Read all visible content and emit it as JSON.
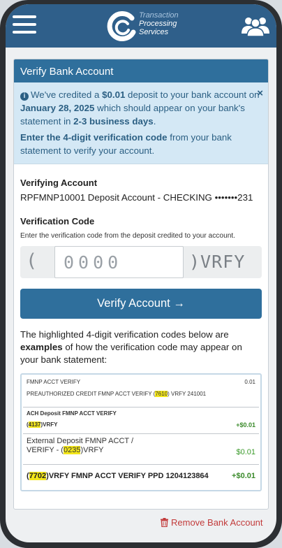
{
  "header": {
    "logo_lines": [
      "Transaction",
      "Processing",
      "Services"
    ]
  },
  "card": {
    "title": "Verify Bank Account"
  },
  "alert": {
    "p1_a": "We've credited a ",
    "amount": "$0.01",
    "p1_b": " deposit to your bank account on ",
    "date": "January 28, 2025",
    "p1_c": " which should appear on your bank's statement in ",
    "days": "2-3 business days",
    "p1_d": ".",
    "p2_bold": "Enter the 4-digit verification code",
    "p2_rest": " from your bank statement to verify your account.",
    "close": "×"
  },
  "verifying": {
    "label": "Verifying Account",
    "value": "RPFMNP10001 Deposit Account - CHECKING •••••••231"
  },
  "verification": {
    "label": "Verification Code",
    "help": "Enter the verification code from the deposit credited to your account.",
    "paren_open": "(",
    "placeholder": "0000",
    "suffix": ")VRFY"
  },
  "verify_button": "Verify Account →",
  "examples_intro": {
    "a": "The highlighted 4-digit verification codes below are ",
    "bold": "examples",
    "b": " of how the verification code may appear on your bank statement:"
  },
  "examples": {
    "e1": {
      "desc": "FMNP ACCT VERIFY",
      "amount": "0.01",
      "line2_a": "PREAUTHORIZED CREDIT FMNP ACCT VERIFY (",
      "code": "7610",
      "line2_b": ") VRFY 241001"
    },
    "e2": {
      "line1": "ACH Deposit FMNP ACCT VERIFY",
      "open": "(",
      "code": "4137",
      "close": ")VRFY",
      "amount": "+$0.01"
    },
    "e3": {
      "line1": "External Deposit FMNP ACCT /",
      "line2_a": "VERIFY - (",
      "code": "0235",
      "line2_b": ")VRFY",
      "amount": "$0.01"
    },
    "e4": {
      "open": "(",
      "code": "7702",
      "rest": ")VRFY FMNP ACCT VERIFY PPD 1204123864",
      "amount": "+$0.01"
    }
  },
  "remove_link": "Remove Bank Account",
  "colors": {
    "header": "#2f5f8a",
    "primary": "#2f6f9c",
    "alert_bg": "#d4e8f5",
    "highlight": "#f3e61a",
    "danger": "#c23b3b",
    "positive": "#3a8a2a"
  },
  "icons": [
    "hamburger-menu-icon",
    "tps-logo-icon",
    "people-icon",
    "info-icon",
    "close-icon",
    "arrow-right-icon",
    "trash-icon"
  ]
}
